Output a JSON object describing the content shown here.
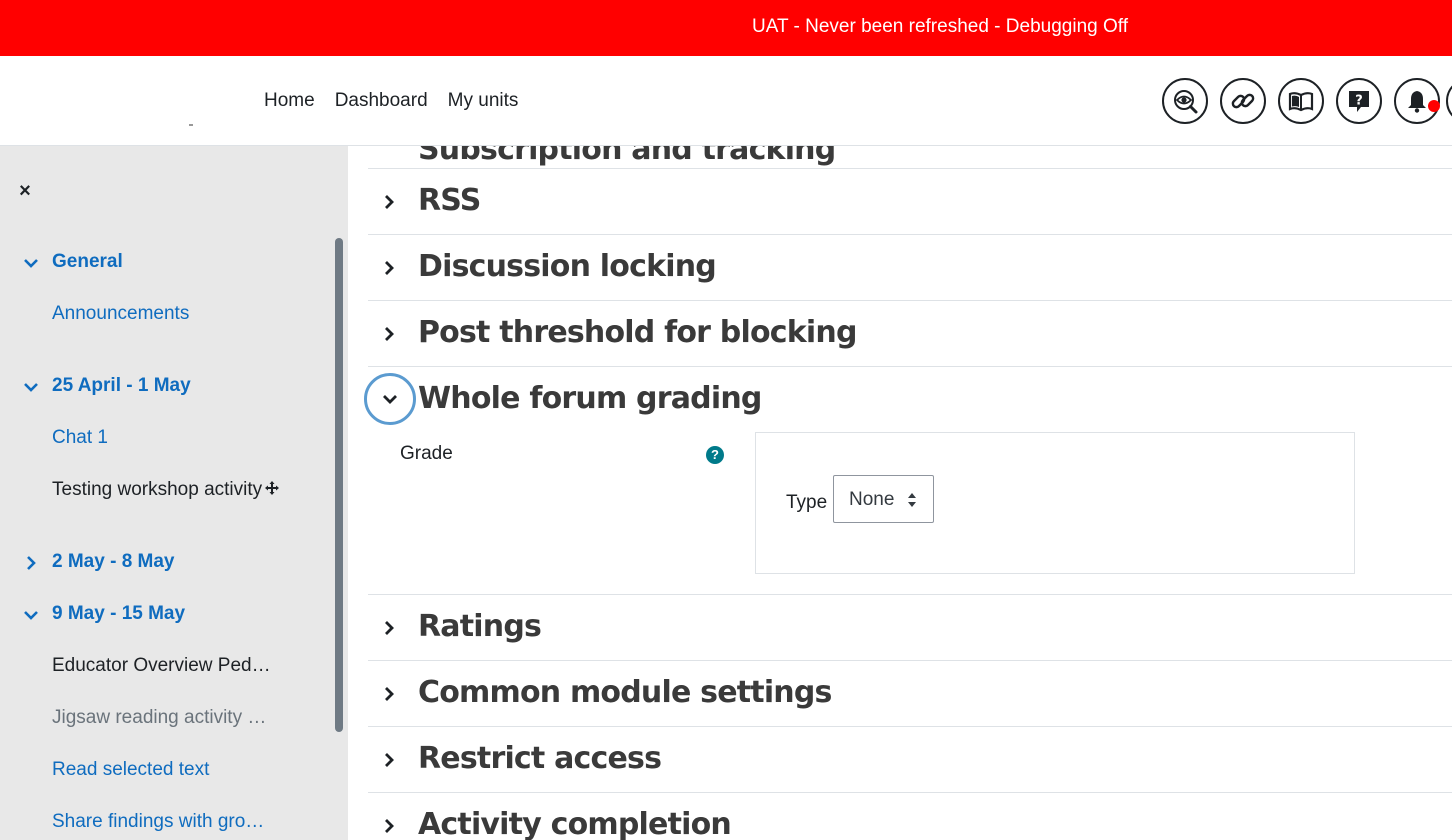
{
  "banner": {
    "text": "UAT - Never been refreshed - Debugging Off",
    "color": "#ff0000"
  },
  "nav": {
    "links": [
      "Home",
      "Dashboard",
      "My units"
    ],
    "icons": [
      "accessibility-eye-icon",
      "link-icon",
      "book-icon",
      "help-icon",
      "notification-bell-icon"
    ]
  },
  "course_index": {
    "close_label": "×",
    "items": [
      {
        "type": "section",
        "label": "General",
        "expanded": true
      },
      {
        "type": "activity",
        "label": "Announcements",
        "style": "link"
      },
      {
        "type": "section",
        "label": "25 April - 1 May",
        "expanded": true
      },
      {
        "type": "activity",
        "label": "Chat 1",
        "style": "link"
      },
      {
        "type": "activity",
        "label": "Testing workshop activity",
        "style": "dark"
      },
      {
        "type": "section",
        "label": "2 May - 8 May",
        "expanded": false
      },
      {
        "type": "section",
        "label": "9 May - 15 May",
        "expanded": true
      },
      {
        "type": "activity",
        "label": "Educator Overview Ped…",
        "style": "dark"
      },
      {
        "type": "activity",
        "label": "Jigsaw reading activity …",
        "style": "muted"
      },
      {
        "type": "activity",
        "label": "Read selected text",
        "style": "link"
      },
      {
        "type": "activity",
        "label": "Share findings with gro…",
        "style": "link"
      }
    ]
  },
  "form": {
    "clipped_title": "Subscription and tracking",
    "sections": [
      {
        "title": "RSS",
        "expanded": false
      },
      {
        "title": "Discussion locking",
        "expanded": false
      },
      {
        "title": "Post threshold for blocking",
        "expanded": false
      },
      {
        "title": "Whole forum grading",
        "expanded": true
      },
      {
        "title": "Ratings",
        "expanded": false
      },
      {
        "title": "Common module settings",
        "expanded": false
      },
      {
        "title": "Restrict access",
        "expanded": false
      },
      {
        "title": "Activity completion",
        "expanded": false
      }
    ],
    "grade": {
      "label": "Grade",
      "help": "?",
      "type_label": "Type",
      "type_value": "None"
    }
  },
  "colors": {
    "link": "#0f6cbf",
    "drawer_bg": "#e8e8e8",
    "help": "#007a8a"
  }
}
